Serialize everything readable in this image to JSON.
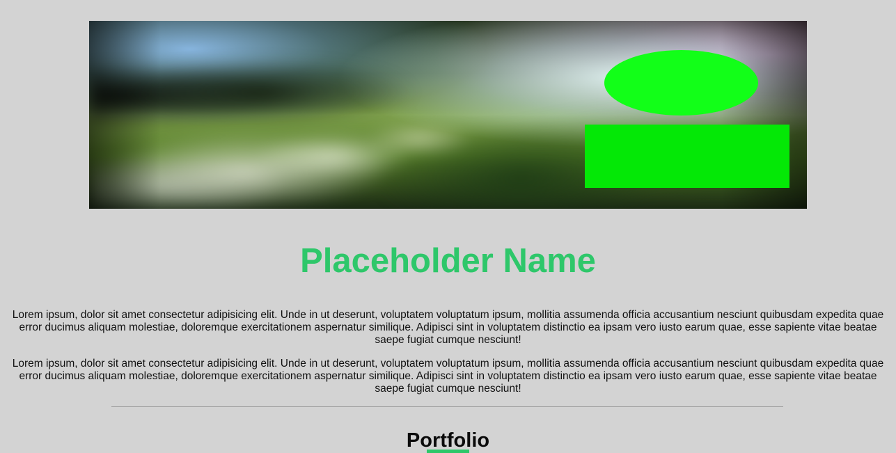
{
  "profile": {
    "name": "Placeholder Name"
  },
  "intro": {
    "paragraphs": [
      "Lorem ipsum, dolor sit amet consectetur adipisicing elit. Unde in ut deserunt, voluptatem voluptatum ipsum, mollitia assumenda officia accusantium nesciunt quibusdam expedita quae error ducimus aliquam molestiae, doloremque exercitationem aspernatur similique. Adipisci sint in voluptatem distinctio ea ipsam vero iusto earum quae, esse sapiente vitae beatae saepe fugiat cumque nesciunt!",
      "Lorem ipsum, dolor sit amet consectetur adipisicing elit. Unde in ut deserunt, voluptatem voluptatum ipsum, mollitia assumenda officia accusantium nesciunt quibusdam expedita quae error ducimus aliquam molestiae, doloremque exercitationem aspernatur similique. Adipisci sint in voluptatem distinctio ea ipsam vero iusto earum quae, esse sapiente vitae beatae saepe fugiat cumque nesciunt!"
    ]
  },
  "portfolio": {
    "title": "Portfolio"
  },
  "colors": {
    "background": "#d3d3d3",
    "accent": "#2ec76a",
    "hero_shape_green": "#12ff18"
  }
}
